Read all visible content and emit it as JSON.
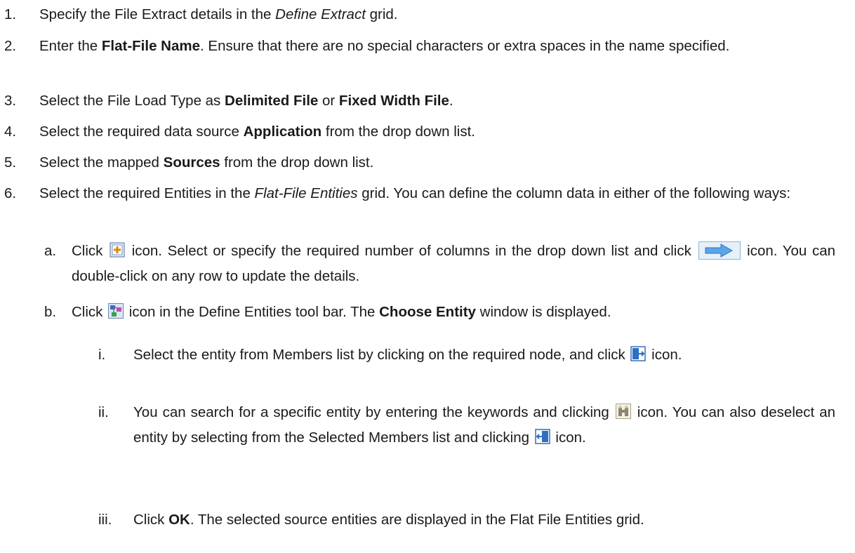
{
  "steps": [
    {
      "num": "1.",
      "t1": "Specify the File Extract details in the ",
      "em1": "Define Extract",
      "t2": " grid."
    },
    {
      "num": "2.",
      "t1": "Enter the ",
      "b1": "Flat-File Name",
      "t2": ". Ensure that there are no special characters or extra spaces in the name specified."
    },
    {
      "num": "3.",
      "t1": "Select the File Load Type as ",
      "b1": "Delimited File",
      "t2": " or ",
      "b2": "Fixed Width File",
      "t3": "."
    },
    {
      "num": "4.",
      "t1": "Select the required data source ",
      "b1": "Application",
      "t2": " from the drop down list."
    },
    {
      "num": "5.",
      "t1": "Select the mapped ",
      "b1": "Sources",
      "t2": " from the drop down list."
    },
    {
      "num": "6.",
      "t1": "Select the required Entities in the ",
      "em1": "Flat-File Entities",
      "t2": " grid. You can define the column data in either of the following ways:"
    }
  ],
  "sub_a": {
    "num": "a.",
    "t1": "Click ",
    "t2": " icon. Select or specify the required number of columns in the drop down list and click ",
    "t3": " icon. You can double-click on any row to update the details."
  },
  "sub_b": {
    "num": "b.",
    "t1": "Click ",
    "t2": " icon in the Define Entities tool bar. The ",
    "b1": "Choose Entity",
    "t3": " window is displayed."
  },
  "sub_i": {
    "num": "i.",
    "t1": "Select the entity from Members list by clicking on the required node, and click ",
    "t2": " icon."
  },
  "sub_ii": {
    "num": "ii.",
    "t1": "You can search for a specific entity by entering the keywords and clicking ",
    "t2": " icon. You can also deselect an entity by selecting from the Selected Members list and clicking ",
    "t3": " icon."
  },
  "sub_iii": {
    "num": "iii.",
    "t1": "Click ",
    "b1": "OK",
    "t2": ". The selected source entities are displayed in the Flat File Entities grid."
  },
  "icons": [
    "add-columns-icon",
    "arrow-right-icon",
    "choose-entity-icon",
    "select-member-icon",
    "search-icon",
    "deselect-member-icon"
  ],
  "colors": {
    "text": "#1a1a1a",
    "icon_blue": "#2f6fc0"
  }
}
